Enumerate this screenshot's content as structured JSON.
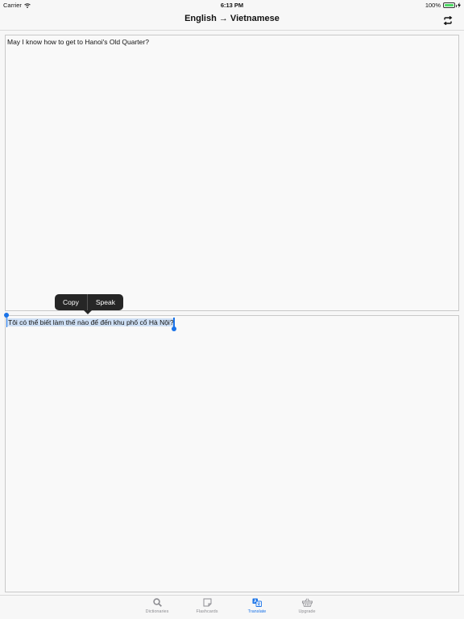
{
  "status_bar": {
    "carrier": "Carrier",
    "time": "6:13 PM",
    "battery_percent": "100%",
    "battery_level": 1.0
  },
  "nav": {
    "title": "English → Vietnamese",
    "swap_icon": "swap-arrows-icon"
  },
  "source": {
    "text": "May I know how to get to Hanoi's Old Quarter?"
  },
  "target": {
    "text": "Tôi có thể biết làm thế nào để đến khu phố cổ Hà Nội?"
  },
  "edit_menu": {
    "copy_label": "Copy",
    "speak_label": "Speak"
  },
  "tabs": [
    {
      "label": "Dictionaries",
      "icon": "search-icon",
      "active": false
    },
    {
      "label": "Flashcards",
      "icon": "note-icon",
      "active": false
    },
    {
      "label": "Translate",
      "icon": "translate-icon",
      "active": true
    },
    {
      "label": "Upgrade",
      "icon": "basket-icon",
      "active": false
    }
  ],
  "colors": {
    "accent": "#1a73e8",
    "selection": "#cfe0f5",
    "menu_bg": "#262626",
    "battery": "#4cd964"
  }
}
